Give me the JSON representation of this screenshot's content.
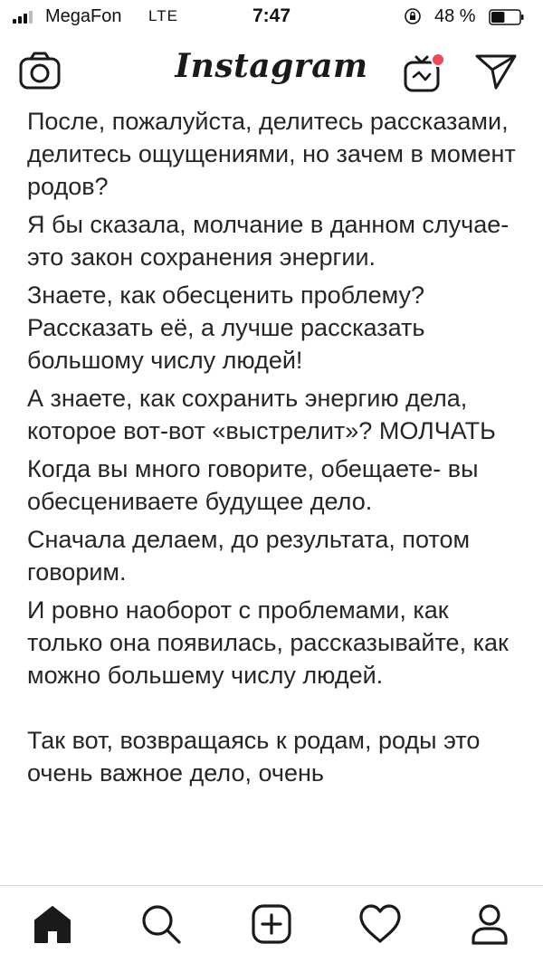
{
  "status_bar": {
    "carrier": "MegaFon",
    "network": "LTE",
    "time": "7:47",
    "battery": "48 %",
    "battery_level": 0.48
  },
  "header": {
    "logo": "Instagram"
  },
  "caption": {
    "paragraphs": [
      "После, пожалуйста, делитесь рассказами, делитесь ощущениями, но зачем в момент родов?",
      "Я бы сказала, молчание в данном случае- это закон сохранения энергии.",
      "Знаете, как обесценить проблему? Рассказать её, а лучше рассказать большому числу людей!",
      "А знаете, как сохранить энергию дела, которое вот-вот «выстрелит»? МОЛЧАТЬ",
      "Когда вы много говорите, обещаете- вы обесцениваете будущее дело.",
      "Сначала делаем, до результата, потом говорим.",
      "И ровно наоборот с проблемами, как только она появилась, рассказывайте, как можно большему числу людей.",
      "Так вот, возвращаясь к родам, роды это очень важное дело, очень"
    ]
  },
  "icons": {
    "camera": "camera-icon",
    "igtv": "igtv-icon",
    "direct": "direct-message-icon",
    "home": "home-icon",
    "search": "search-icon",
    "add": "add-post-icon",
    "activity": "heart-icon",
    "profile": "profile-icon"
  },
  "colors": {
    "notification_dot": "#ed4956",
    "text": "#262626"
  }
}
